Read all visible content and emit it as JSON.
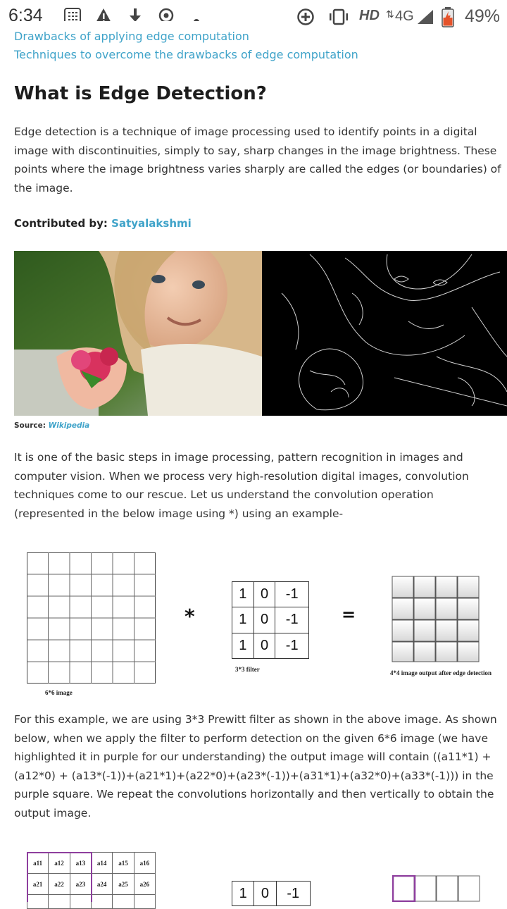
{
  "status_bar": {
    "time": "6:34",
    "network": "HD",
    "signal": "4G",
    "battery": "49%",
    "icons": [
      "calculator-icon",
      "warning-icon",
      "download-icon",
      "location-icon",
      "dot-icon",
      "data-saver-icon",
      "vibrate-icon",
      "signal-icon",
      "battery-icon"
    ]
  },
  "toc": [
    "Drawbacks of applying edge computation",
    "Techniques to overcome the drawbacks of edge computation"
  ],
  "article": {
    "heading": "What is Edge Detection?",
    "intro": "Edge detection is a technique of image processing used to identify points in a digital image with discontinuities, simply to say, sharp changes in the image brightness. These points where the image brightness varies sharply are called the edges (or boundaries) of the image.",
    "contributed_label": "Contributed by:",
    "contributor": "Satyalakshmi",
    "source_label": "Source:",
    "source_link": "Wikipedia",
    "para2": "It is one of the basic steps in image processing, pattern recognition in images and computer vision. When we process very high-resolution digital images, convolution techniques come to our rescue. Let us understand the convolution operation (represented in the below image using *) using an example-",
    "para3": "For this example, we are using 3*3 Prewitt filter as shown in the above image. As shown below, when we apply the filter to perform detection on the given 6*6 image (we have highlighted it in purple for our understanding) the output image will contain ((a11*1) + (a12*0) + (a13*(-1))+(a21*1)+(a22*0)+(a23*(-1))+(a31*1)+(a32*0)+(a33*(-1))) in the purple square.  We repeat the convolutions horizontally and then vertically to obtain the output image."
  },
  "diagram1": {
    "image_label": "6*6 image",
    "filter_label": "3*3 filter",
    "output_label": "4*4 image output after edge detection",
    "conv_symbol": "*",
    "equals_symbol": "=",
    "filter": [
      [
        "1",
        "0",
        "-1"
      ],
      [
        "1",
        "0",
        "-1"
      ],
      [
        "1",
        "0",
        "-1"
      ]
    ]
  },
  "diagram2": {
    "rows": [
      [
        "a11",
        "a12",
        "a13",
        "a14",
        "a15",
        "a16"
      ],
      [
        "a21",
        "a22",
        "a23",
        "a24",
        "a25",
        "a26"
      ]
    ],
    "filter_row": [
      "1",
      "0",
      "-1"
    ]
  },
  "colors": {
    "link": "#3fa3c9",
    "highlight": "#8e3f9e"
  }
}
